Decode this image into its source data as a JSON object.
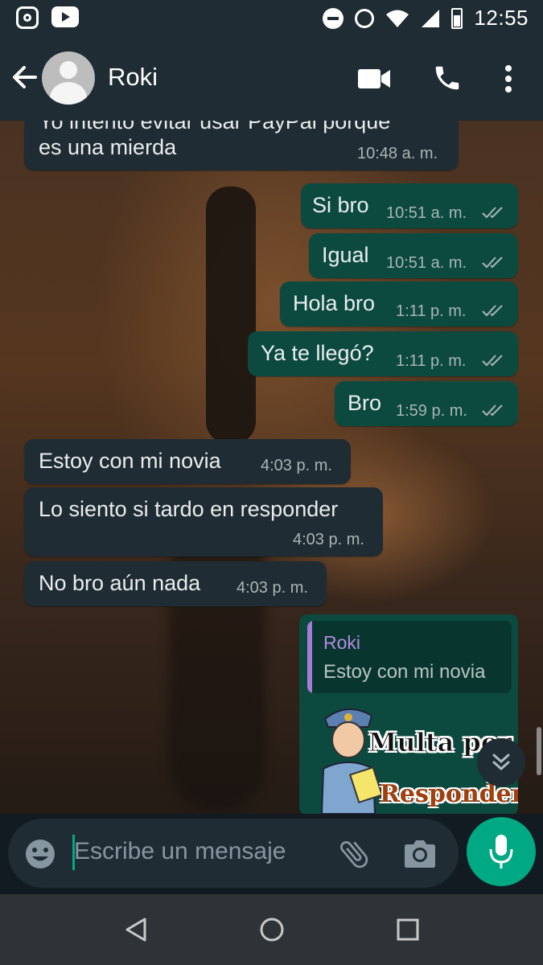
{
  "status_bar": {
    "time": "12:55",
    "left_icons": [
      "instagram-icon",
      "youtube-icon"
    ],
    "right_icons": [
      "do-not-disturb-icon",
      "alarm-icon",
      "wifi-icon",
      "signal-icon",
      "battery-icon"
    ]
  },
  "header": {
    "contact_name": "Roki",
    "icons": [
      "back-arrow-icon",
      "avatar",
      "video-call-icon",
      "voice-call-icon",
      "more-options-icon"
    ]
  },
  "messages": [
    {
      "direction": "in",
      "text_line1": "Yo intento evitar usar PayPal porque",
      "text_line2": "es una mierda",
      "time": "10:48 a. m."
    },
    {
      "direction": "out",
      "text": "Si bro",
      "time": "10:51 a. m.",
      "status": "read"
    },
    {
      "direction": "out",
      "text": "Igual",
      "time": "10:51 a. m.",
      "status": "read"
    },
    {
      "direction": "out",
      "text": "Hola bro",
      "time": "1:11 p. m.",
      "status": "read"
    },
    {
      "direction": "out",
      "text": "Ya te llegó?",
      "time": "1:11 p. m.",
      "status": "read"
    },
    {
      "direction": "out",
      "text": "Bro",
      "time": "1:59 p. m.",
      "status": "read"
    },
    {
      "direction": "in",
      "text": "Estoy con mi novia",
      "time": "4:03 p. m."
    },
    {
      "direction": "in",
      "text": "Lo siento si tardo en responder",
      "time": "4:03 p. m."
    },
    {
      "direction": "in",
      "text": "No bro aún nada",
      "time": "4:03 p. m."
    }
  ],
  "reply_message": {
    "quoted_name": "Roki",
    "quoted_text": "Estoy con mi novia",
    "sticker_text_1": "Multa por",
    "sticker_text_2": "Responder"
  },
  "input": {
    "placeholder": "Escribe un mensaje",
    "icons": [
      "emoji-icon",
      "attach-icon",
      "camera-icon",
      "mic-icon"
    ]
  },
  "colors": {
    "header_bg": "#1f2c34",
    "incoming_bubble": "#202c33",
    "outgoing_bubble": "#0c4a40",
    "accent": "#00a884",
    "quoted_name": "#b48ae0"
  }
}
